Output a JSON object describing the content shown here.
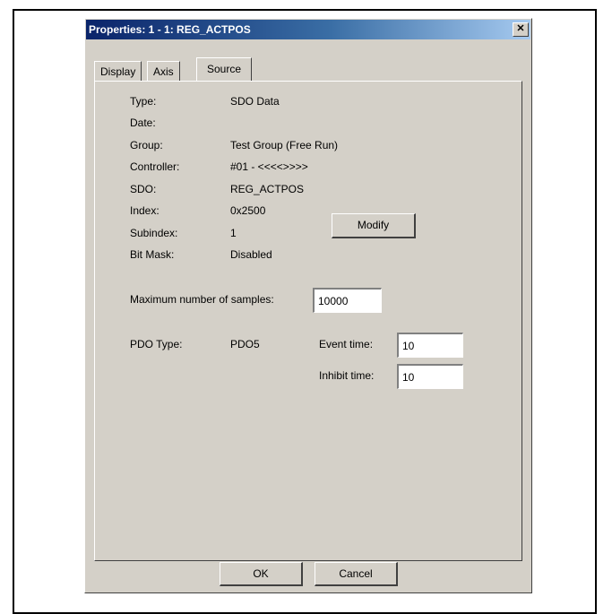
{
  "window": {
    "title": "Properties: 1 - 1: REG_ACTPOS",
    "close_glyph": "✕"
  },
  "tabs": [
    {
      "label": "Display"
    },
    {
      "label": "Axis"
    },
    {
      "label": "Source",
      "active": true
    }
  ],
  "source": {
    "rows": [
      {
        "label": "Type:",
        "value": "SDO Data"
      },
      {
        "label": "Date:",
        "value": ""
      },
      {
        "label": "Group:",
        "value": "Test Group (Free Run)"
      },
      {
        "label": "Controller:",
        "value": "#01 - <<<<>>>>"
      },
      {
        "label": "SDO:",
        "value": "REG_ACTPOS"
      },
      {
        "label": "Index:",
        "value": "0x2500"
      },
      {
        "label": "Subindex:",
        "value": "1"
      },
      {
        "label": "Bit Mask:",
        "value": "Disabled"
      }
    ],
    "modify_label": "Modify",
    "max_samples_label": "Maximum number of samples:",
    "max_samples_value": "10000",
    "pdo_type_label": "PDO Type:",
    "pdo_type_value": "PDO5",
    "event_time_label": "Event time:",
    "event_time_value": "10",
    "inhibit_time_label": "Inhibit time:",
    "inhibit_time_value": "10"
  },
  "buttons": {
    "ok_label": "OK",
    "cancel_label": "Cancel"
  }
}
